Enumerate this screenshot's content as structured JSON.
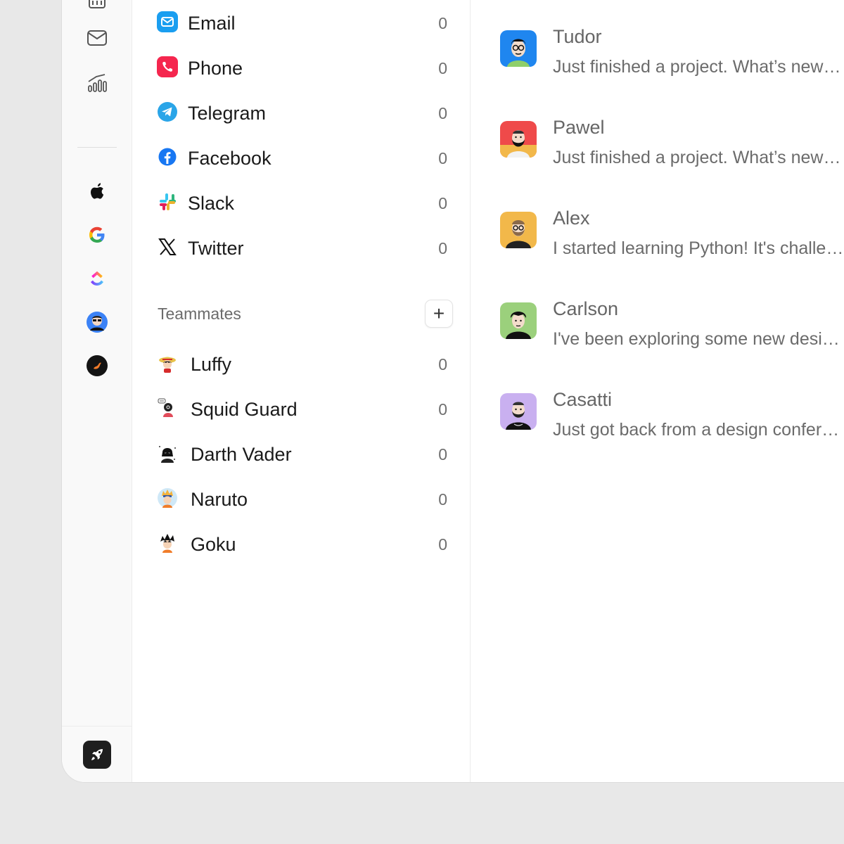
{
  "channels": [
    {
      "label": "Email",
      "count": "0",
      "icon": "email-icon",
      "color": "#1a9ef0"
    },
    {
      "label": "Phone",
      "count": "0",
      "icon": "phone-icon",
      "color": "#f5264e"
    },
    {
      "label": "Telegram",
      "count": "0",
      "icon": "telegram-icon",
      "color": "#2aa5e8"
    },
    {
      "label": "Facebook",
      "count": "0",
      "icon": "facebook-icon",
      "color": "#1877f2"
    },
    {
      "label": "Slack",
      "count": "0",
      "icon": "slack-icon"
    },
    {
      "label": "Twitter",
      "count": "0",
      "icon": "x-icon"
    }
  ],
  "teammates": {
    "title": "Teammates",
    "add_symbol": "+",
    "items": [
      {
        "label": "Luffy",
        "count": "0"
      },
      {
        "label": "Squid Guard",
        "count": "0"
      },
      {
        "label": "Darth Vader",
        "count": "0"
      },
      {
        "label": "Naruto",
        "count": "0"
      },
      {
        "label": "Goku",
        "count": "0"
      }
    ]
  },
  "conversations": [
    {
      "name": "Tudor",
      "message": "Just finished a project. What’s new with you?",
      "avatar_bg": "#1f86ef"
    },
    {
      "name": "Pawel",
      "message": "Just finished a project. What’s new with you?",
      "avatar_bg": "#ef4a4a"
    },
    {
      "name": "Alex",
      "message": "I started learning Python! It's challenging but fun.",
      "avatar_bg": "#f2b84a"
    },
    {
      "name": "Carlson",
      "message": "I've been exploring some new design tools lately.",
      "avatar_bg": "#9bd07c"
    },
    {
      "name": "Casatti",
      "message": "Just got back from a design conference.",
      "avatar_bg": "#c9b0f0"
    }
  ],
  "rail": {
    "icons": [
      "calendar-icon",
      "mail-icon",
      "analytics-icon",
      "apple-icon",
      "google-icon",
      "clickup-icon",
      "profile-avatar",
      "workspace-avatar",
      "rocket-icon"
    ]
  },
  "colors": {
    "background": "#e8e8e8",
    "panel": "#ffffff",
    "rail": "#f9f9f9"
  }
}
